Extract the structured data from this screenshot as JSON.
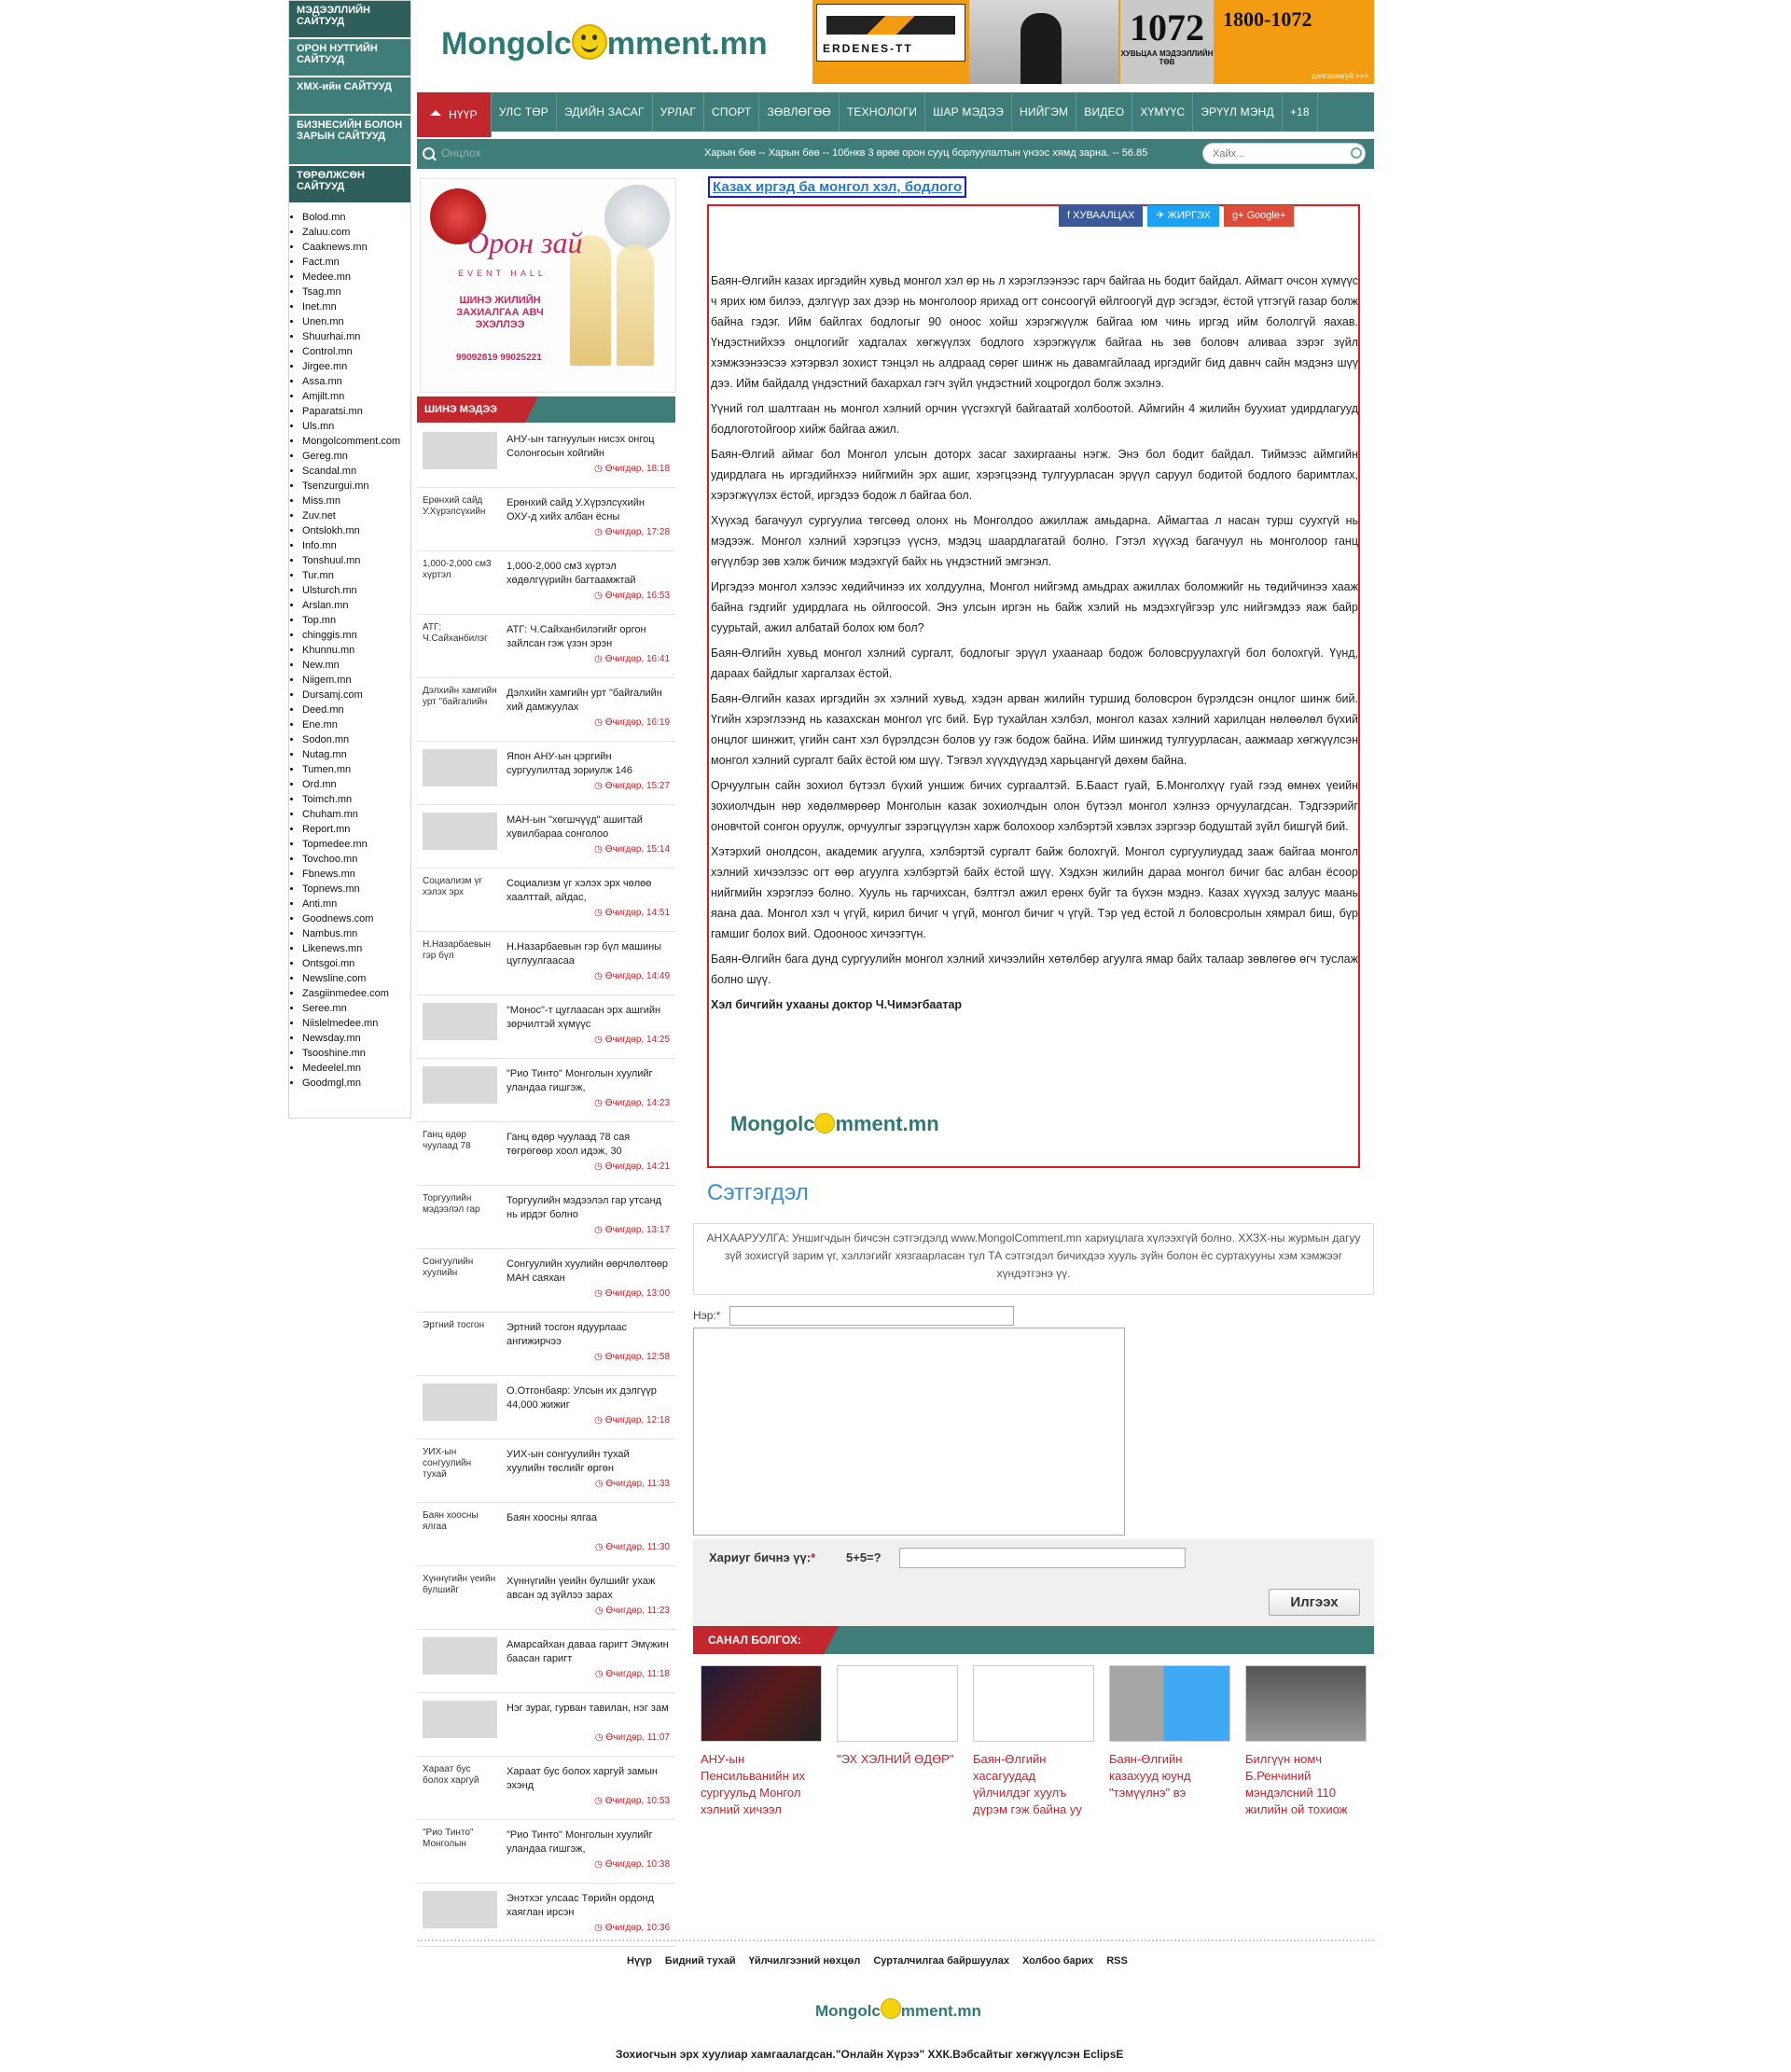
{
  "directory": {
    "headers": [
      "МЭДЭЭЛЛИЙН САЙТУУД",
      "ОРОН НУТГИЙН САЙТУУД",
      "ХМХ-ийн САЙТУУД",
      "БИЗНЕСИЙН БОЛОН ЗАРЫН САЙТУУД",
      "ТӨРӨЛЖСӨН САЙТУУД"
    ],
    "sites": [
      "Bolod.mn",
      "Zaluu.com",
      "Caaknews.mn",
      "Fact.mn",
      "Medee.mn",
      "Tsag.mn",
      "Inet.mn",
      "Unen.mn",
      "Shuurhai.mn",
      "Control.mn",
      "Jirgee.mn",
      "Assa.mn",
      "Amjilt.mn",
      "Paparatsi.mn",
      "Uls.mn",
      "Mongolcomment.com",
      "Gereg.mn",
      "Scandal.mn",
      "Tsenzurgui.mn",
      "Miss.mn",
      "Zuv.net",
      "Ontslokh.mn",
      "Info.mn",
      "Tonshuul.mn",
      "Tur.mn",
      "Ulsturch.mn",
      "Arslan.mn",
      "Top.mn",
      "chinggis.mn",
      "Khunnu.mn",
      "New.mn",
      "Niigem.mn",
      "Dursamj.com",
      "Deed.mn",
      "Ene.mn",
      "Sodon.mn",
      "Nutag.mn",
      "Tumen.mn",
      "Ord.mn",
      "Toimch.mn",
      "Chuham.mn",
      "Report.mn",
      "Topmedee.mn",
      "Tovchoo.mn",
      "Fbnews.mn",
      "Topnews.mn",
      "Anti.mn",
      "Goodnews.com",
      "Nambus.mn",
      "Likenews.mn",
      "Ontsgoi.mn",
      "Newsline.com",
      "Zasgiinmedee.com",
      "Seree.mn",
      "Niislelmedee.mn",
      "Newsday.mn",
      "Tsooshine.mn",
      "Medeelel.mn",
      "Goodmgl.mn"
    ]
  },
  "header": {
    "logo_pre": "Mongolc",
    "logo_post": "mment.mn",
    "banner": {
      "company": "ERDENES-TT",
      "number": "1072",
      "number_sub": "ХУВЬЦАА МЭДЭЭЛЛИЙН ТӨВ",
      "phone": "1800-1072",
      "link": "дэлгэрэнгүй >>>"
    }
  },
  "nav": {
    "items": [
      "НҮҮР",
      "УЛС ТӨР",
      "ЭДИЙН ЗАСАГ",
      "УРЛАГ",
      "СПОРТ",
      "ЗӨВЛӨГӨӨ",
      "ТЕХНОЛОГИ",
      "ШАР МЭДЭЭ",
      "НИЙГЭМ",
      "ВИДЕО",
      "ХҮМҮҮС",
      "ЭРҮҮЛ МЭНД",
      "+18"
    ]
  },
  "ticker": {
    "label": "Онцлох",
    "text": "Харын бөө -- Харын бөө -- 10бнкв 3 өрөө орон сууц борлуулалтын үнээс хямд зарна. -- 56.85",
    "search_placeholder": "Хайх..."
  },
  "ad": {
    "title": "Орон зай",
    "sub": "EVENT HALL",
    "mid": "ШИНЭ ЖИЛИЙН ЗАХИАЛГАА АВЧ ЭХЭЛЛЭЭ",
    "phone": "99092819 99025221"
  },
  "news": {
    "header": "ШИНЭ МЭДЭЭ",
    "items": [
      {
        "thumb": "",
        "title": "АНУ-ын тагнуулын нисэх онгоц Солонгосын хойгийн",
        "date": "Өчигдөр, 18:18"
      },
      {
        "thumb": "Ерөнхий сайд У.Хүрэлсүхийн",
        "title": "Ерөнхий сайд У.Хүрэлсүхийн ОХУ-д хийх албан ёсны",
        "date": "Өчигдөр, 17:28"
      },
      {
        "thumb": "1,000-2,000 см3 хүртэл",
        "title": "1,000-2,000 см3 хүртэл хөдөлгүүрийн багтаамжтай",
        "date": "Өчигдөр, 16:53"
      },
      {
        "thumb": "АТГ: Ч.Сайханбилэг",
        "title": "АТГ: Ч.Сайханбилэгийг оргон зайлсан гэж үзэн эрэн",
        "date": "Өчигдөр, 16:41"
      },
      {
        "thumb": "Дэлхийн хамгийн урт \"байгалийн",
        "title": "Дэлхийн хамгийн урт \"байгалийн хий дамжуулах",
        "date": "Өчигдөр, 16:19"
      },
      {
        "thumb": "",
        "title": "Япон АНУ-ын цэргийн сургуулилтад зориулж 146",
        "date": "Өчигдөр, 15:27"
      },
      {
        "thumb": "",
        "title": "МАН-ын \"хөгшчүүд\" ашигтай хувилбараа сонголоо",
        "date": "Өчигдөр, 15:14"
      },
      {
        "thumb": "Социализм үг хэлэх эрх",
        "title": "Социализм үг хэлэх эрх чөлөө хаалттай, айдас,",
        "date": "Өчигдөр, 14:51"
      },
      {
        "thumb": "Н.Назарбаевын гэр бүл",
        "title": "Н.Назарбаевын гэр бүл машины цуглуулгаасаа",
        "date": "Өчигдөр, 14:49"
      },
      {
        "thumb": "",
        "title": "\"Монос\"-т цуглаасан эрх ашгийн зөрчилтэй хүмүүс",
        "date": "Өчигдөр, 14:25"
      },
      {
        "thumb": "",
        "title": "\"Рио Тинто\" Монголын хуулийг уландаа гишгэж,",
        "date": "Өчигдөр, 14:23"
      },
      {
        "thumb": "Ганц өдөр чуулаад 78",
        "title": "Ганц өдөр чуулаад 78 сая төгрөгөөр хоол идэж, 30",
        "date": "Өчигдөр, 14:21"
      },
      {
        "thumb": "Торгуулийн мэдээлэл гар",
        "title": "Торгуулийн мэдээлэл гар утсанд нь ирдэг болно",
        "date": "Өчигдөр, 13:17"
      },
      {
        "thumb": "Сонгуулийн хуулийн",
        "title": "Сонгуулийн хуулийн өөрчлөлтөөр МАН саяхан",
        "date": "Өчигдөр, 13:00"
      },
      {
        "thumb": "Эртний тосгон",
        "title": "Эртний тосгон ядуурлаас ангижирчээ",
        "date": "Өчигдөр, 12:58"
      },
      {
        "thumb": "",
        "title": "О.Отгонбаяр: Улсын их дэлгүүр 44,000 жижиг",
        "date": "Өчигдөр, 12:18"
      },
      {
        "thumb": "УИХ-ын сонгуулийн тухай",
        "title": "УИХ-ын сонгуулийн тухай хуулийн төслийг өргөн",
        "date": "Өчигдөр, 11:33"
      },
      {
        "thumb": "Баян хоосны ялгаа",
        "title": "Баян хоосны ялгаа",
        "date": "Өчигдөр, 11:30"
      },
      {
        "thumb": "Хүннүгийн үеийн булшийг",
        "title": "Хүннүгийн үеийн булшийг ухаж авсан эд зүйлээ зарах",
        "date": "Өчигдөр, 11:23"
      },
      {
        "thumb": "",
        "title": "Амарсайхан даваа гаригт Эмүжин баасан гаригт",
        "date": "Өчигдөр, 11:18"
      },
      {
        "thumb": "",
        "title": "Нэг зураг, гурван тавилан, нэг зам",
        "date": "Өчигдөр, 11:07"
      },
      {
        "thumb": "Хараат бус болох харгуй",
        "title": "Хараат бус болох харгуй замын эхэнд",
        "date": "Өчигдөр, 10:53"
      },
      {
        "thumb": "\"Рио Тинто\" Монголын",
        "title": "\"Рио Тинто\" Монголын хуулийг уландаа гишгэж,",
        "date": "Өчигдөр, 10:38"
      },
      {
        "thumb": "",
        "title": "Энэтхэг улсаас Төрийн ордонд хаяглан ирсэн",
        "date": "Өчигдөр, 10:36"
      }
    ]
  },
  "article": {
    "title": "Казах иргэд ба монгол хэл, бодлого",
    "share": {
      "fb": "ХУВААЛЦАХ",
      "tw": "ЖИРГЭХ",
      "gp": "Google+"
    },
    "paragraphs": [
      "Баян-Өлгийн казах иргэдийн хувьд монгол хэл өр нь л хэрэглээнээс гарч байгаа нь бодит байдал. Аймагт очсон хүмүүс ч ярих юм билээ, дэлгүүр зах дээр нь монголоор ярихад огт сонсоогүй өйлгоогүй дүр эсгэдэг, ёстой үтгэгүй газар болж байна гэдэг. Ийм байлгах бодлогыг 90 оноос хойш хэрэгжүүлж байгаа юм чинь иргэд ийм бололгүй яахав. Үндэстнийхээ онцлогийг хадгалах хөгжүүлэх бодлого хэрэгжүүлж байгаа нь зөв боловч аливаа зэрэг зүйл хэмжээнээсээ хэтэрвэл зохист тэнцэл нь алдраад сөрөг шинж нь давамгайлаад иргэдийг бид давнч сайн мэдэнэ шүү дээ. Ийм байдалд үндэстний бахархал гэгч зүйл үндэстний хоцрогдол болж эхэлнэ.",
      "Үүний гол шалтгаан нь монгол хэлний орчин үүсгэхгүй байгаатай холбоотой. Аймгийн 4 жилийн буухиат удирдлагууд бодлоготойгоор хийж байгаа ажил.",
      "Баян-Өлгий аймаг бол Монгол улсын доторх засаг захиргааны нэгж. Энэ бол бодит байдал. Тиймээс аймгийн удирдлага нь иргэдийнхээ нийгмийн эрх ашиг, хэрэгцээнд тулгуурласан эрүүл саруул бодитой бодлого баримтлах, хэрэгжүүлэх ёстой, иргэдээ бодож л байгаа бол.",
      "Хүүхэд багачуул сургуулиа төгсөөд олонх нь Монголдоо ажиллаж амьдарна. Аймагтаа л насан турш суухгүй нь мэдээж. Монгол хэлний хэрэгцээ үүснэ, мэдэц шаардлагатай болно. Гэтэл хүүхэд багачуул нь монголоор ганц өгүүлбэр зөв хэлж бичиж мэдэхгүй байх нь үндэстний эмгэнэл.",
      "Иргэдээ монгол хэлээс хөдийчинээ их холдуулна, Монгол нийгэмд амьдрах ажиллах боломжийг нь төдийчинээ хааж байна гэдгийг удирдлага нь ойлгоосой. Энэ улсын иргэн нь байж хэлий нь мэдэхгүйгээр улс нийгэмдээ яаж байр суурьтай, ажил албатай болох юм бол?",
      "Баян-Өлгийн хувьд монгол хэлний сургалт, бодлогыг эрүүл ухаанаар бодож боловсруулахгүй бол болохгүй. Үүнд, дараах байдлыг харгалзах ёстой.",
      "Баян-Өлгийн казах иргэдийн эх хэлний хувьд, хэдэн арван жилийн туршид боловсрон бүрэлдсэн онцлог шинж бий. Үгийн хэрэглээнд нь казахскан монгол үгс бий. Бүр тухайлан хэлбэл, монгол казах хэлний харилцан нөлөөлөл бүхий онцлог шинжит, үгийн сант хэл бүрэлдсэн болов уу гэж бодож байна. Ийм шинжид тулгуурласан, аажмаар хөгжүүлсэн монгол хэлний сургалт байх ёстой юм шүү. Тэгвэл хүүхдүүдэд харьцангүй дөхөм байна.",
      "Орчуулгын сайн зохиол бүтээл бүхий уншиж бичих сургаалтэй. Б.Бааст гуай, Б.Монголхүү гуай гээд өмнөх үеийн зохиолчдын нөр хөдөлмөрөөр Монголын казак зохиолчдын олон бүтээл монгол хэлнээ орчуулагдсан. Тэдгээрийг оновчтой сонгон оруулж, орчуулгыг зэрэгцүүлэн харж болохоор хэлбэртэй хэвлэх зэргээр бодуштай зүйл бишгүй бий.",
      "Хэтэрхий онолдсон, академик агуулга, хэлбэртэй сургалт байж болохгүй. Монгол сургуулиудад зааж байгаа монгол хэлний хичээлээс огт өөр агуулга хэлбэртэй байх ёстой шүү. Хэдхэн жилийн дараа монгол бичиг бас албан ёсоор нийгмийн хэрэглээ болно. Хууль нь гарчихсан, бэлтгэл ажил ерөнх буйг та бүхэн мэднэ. Казах хүүхэд залуус маань яана даа. Монгол хэл ч үгүй, кирил бичиг ч үгүй, монгол бичиг ч үгүй. Тэр үед ёстой л боловсролын хямрал биш, бүр гамшиг болох вий. Одооноос хичээгтүн.",
      "Баян-Өлгийн бага дунд сургуулийн монгол хэлний хичээлийн хөтөлбөр агуулга ямар байх талаар зөвлөгөө өгч туслаж болно шүү."
    ],
    "author": "Хэл бичгийн ухааны доктор Ч.Чимэгбаатар"
  },
  "comments": {
    "title": "Сэтгэгдэл",
    "notice": "АНХААРУУЛГА: Уншигчдын бичсэн сэтгэгдэлд www.MongolComment.mn хариуцлага хүлээхгүй болно. ХХЗХ-ны журмын дагуу зүй зохисгүй зарим үг, хэллэгийг хязгаарласан тул ТА сэтгэгдэл бичихдээ хууль зүйн болон ёс суртахууны хэм хэмжээг хүндэтгэнэ үү.",
    "name_label": "Нэр:",
    "req": "*",
    "captcha_label": "Хариуг бичнэ үү:",
    "captcha_q": "5+5=?",
    "send": "Илгээх"
  },
  "recommend": {
    "header": "САНАЛ БОЛГОХ:",
    "items": [
      {
        "caption": "АНУ-ын Пенсильванийн их сургуульд Монгол хэлний хичээл"
      },
      {
        "caption": "\"ЭХ ХЭЛНИЙ ӨДӨР\""
      },
      {
        "caption": "Баян-Өлгийн хасагуудад үйлчилдэг хуулъ дүрэм гэж байна уу"
      },
      {
        "caption": "Баян-Өлгийн казахууд юунд \"тэмүүлнэ\" вэ"
      },
      {
        "caption": "Билгүүн номч Б.Ренчиний мэндэлсний 110 жилийн ой тохиож"
      }
    ]
  },
  "footer": {
    "links": [
      "Нүүр",
      "Бидний тухай",
      "Үйлчилгээний нөхцөл",
      "Сурталчилгаа байршуулах",
      "Холбоо барих",
      "RSS"
    ],
    "copyright": "Зохиогчын эрх хуулиар хамгаалагдсан.\"Онлайн Хүрээ\" ХХК.Вэбсайтыг хөгжүүлсэн EclipsE"
  }
}
